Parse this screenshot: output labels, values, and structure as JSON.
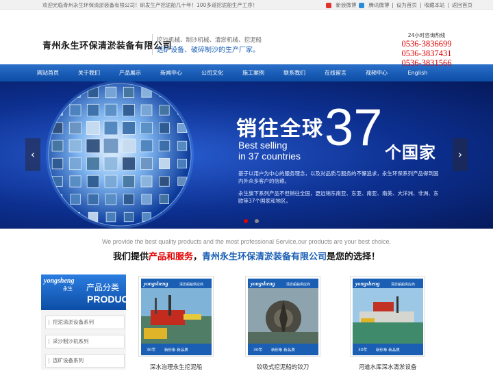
{
  "topbar": {
    "welcome": "欢迎光临青州永生环保清淤装备有限公司！研发生产挖泥船几十年！100多道挖泥船生产工序！",
    "links": [
      "新浪微博",
      "腾讯微博",
      "设为首页",
      "收藏本站",
      "返回首页"
    ]
  },
  "header": {
    "company": "青州永生环保清淤装备有限公司",
    "line1": "挖沙机械、制沙机械、清淤机械、挖泥船",
    "line2": "选矿设备、破碎制沙的生产厂家。",
    "hotline_label": "24小时咨询热线",
    "phones": [
      "0536-3836699",
      "0536-3837431",
      "0536-3831566"
    ]
  },
  "nav": [
    "网站首页",
    "关于我们",
    "产品展示",
    "新闻中心",
    "公司文化",
    "施工案例",
    "联系我们",
    "在线留言",
    "视频中心",
    "English"
  ],
  "banner": {
    "headline_a": "销往全球",
    "headline_num": "37",
    "headline_b": "个国家",
    "en_line1": "Best selling",
    "en_line2": "in 37 countries",
    "para1": "基于以用户为中心的服务理念，以及对品质与服务的不懈追求，永生环保系列产品得到国内外众多客户的信赖。",
    "para2": "永生旗下系列产品不但销往全国，更远销东南亚、东亚、南亚、南美、大洋洲、非洲、东欧等37个国家和地区。",
    "prev": "‹",
    "next": "›"
  },
  "slogan": {
    "en": "We provide the best quality products and the most professional Service,our products are your best choice.",
    "cn_a": "我们提供",
    "cn_b": "产品和服务",
    "cn_c": "，",
    "cn_d": "青州永生环保清淤装备有限公司",
    "cn_e": "是您的选择！"
  },
  "category": {
    "brand": "yongsheng",
    "brand_cn": "永生",
    "title_cn": "产品分类",
    "title_en": "PRODUCTS",
    "items": [
      "挖泥清淤设备系列",
      "采沙制沙机系列",
      "选矿设备系列"
    ]
  },
  "products": [
    {
      "title": "深水治理永生挖泥船",
      "brand": "yongsheng",
      "tag": "清淤船舶供应商",
      "badge": "30年",
      "note": "新形象 新品质"
    },
    {
      "title": "铰吸式挖泥船的铰刀",
      "brand": "yongsheng",
      "tag": "清淤船舶供应商",
      "badge": "30年",
      "note": "新形象 新品质"
    },
    {
      "title": "河道水库深水清淤设备",
      "brand": "yongsheng",
      "tag": "清淤船舶供应商",
      "badge": "30年",
      "note": "新形象 新品质"
    }
  ]
}
